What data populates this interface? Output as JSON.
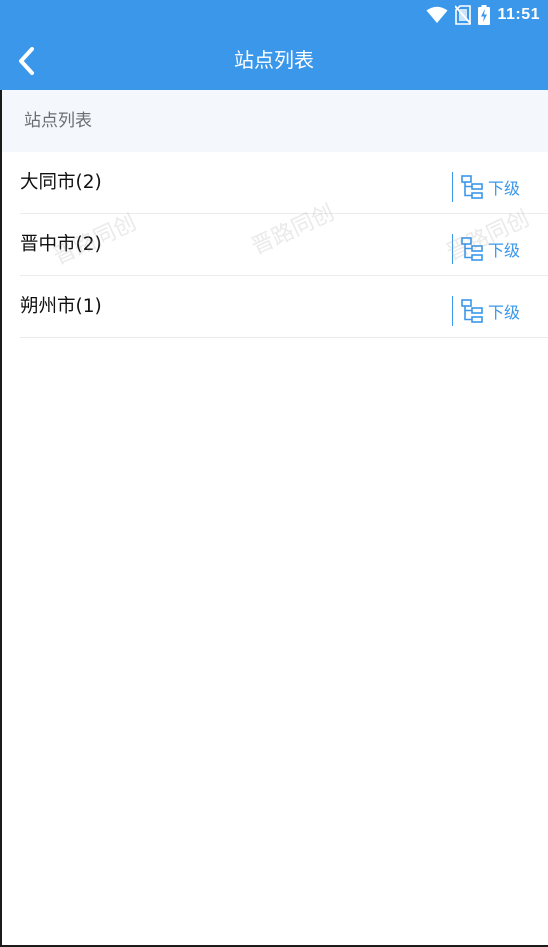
{
  "status_bar": {
    "time": "11:51",
    "icons": [
      "wifi-icon",
      "no-sim-icon",
      "battery-charging-icon"
    ]
  },
  "app_bar": {
    "title": "站点列表",
    "back_icon": "chevron-left-icon"
  },
  "section_header": "站点列表",
  "stations": [
    {
      "name": "大同市(2)",
      "action_label": "下级",
      "action_icon": "tree-structure-icon"
    },
    {
      "name": "晋中市(2)",
      "action_label": "下级",
      "action_icon": "tree-structure-icon"
    },
    {
      "name": "朔州市(1)",
      "action_label": "下级",
      "action_icon": "tree-structure-icon"
    }
  ],
  "watermark_text": "晋路同创",
  "colors": {
    "primary": "#3a97ea",
    "header_bg": "#f4f7fb",
    "text": "#111111",
    "muted_text": "#6a6f75"
  }
}
